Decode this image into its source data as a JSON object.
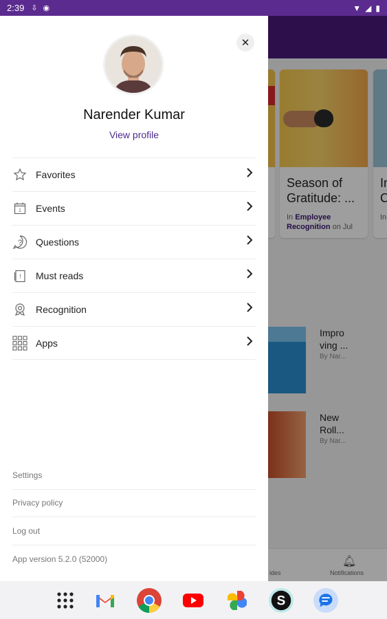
{
  "status_bar": {
    "time": "2:39",
    "icons": [
      "download-icon",
      "messenger-icon",
      "wifi-icon",
      "signal-icon",
      "battery-icon"
    ]
  },
  "background": {
    "cards": [
      {
        "title": "Season of Gratitude: ...",
        "meta_prefix": "In",
        "meta_category": "Employee Recognition",
        "meta_suffix": "on Jul"
      },
      {
        "title": "In C",
        "meta_prefix": "In"
      }
    ],
    "list_items": [
      {
        "title": "Impro ving ...",
        "byline": "By Nar..."
      },
      {
        "title": "New Roll...",
        "byline": "By Nar..."
      }
    ],
    "bottom_nav": {
      "partial_label": "ides",
      "notifications_label": "Notifications"
    }
  },
  "drawer": {
    "user_name": "Narender Kumar",
    "view_profile": "View profile",
    "menu": [
      {
        "label": "Favorites",
        "icon": "star-icon"
      },
      {
        "label": "Events",
        "icon": "calendar-icon"
      },
      {
        "label": "Questions",
        "icon": "question-icon"
      },
      {
        "label": "Must reads",
        "icon": "must-read-icon"
      },
      {
        "label": "Recognition",
        "icon": "recognition-icon"
      },
      {
        "label": "Apps",
        "icon": "apps-grid-icon"
      }
    ],
    "footer": {
      "settings": "Settings",
      "privacy": "Privacy policy",
      "logout": "Log out",
      "version": "App version 5.2.0 (52000)"
    }
  },
  "dock": {
    "apps": [
      "app-drawer-icon",
      "gmail-icon",
      "chrome-icon",
      "youtube-icon",
      "photos-icon",
      "s-app-icon",
      "messages-icon"
    ]
  },
  "colors": {
    "brand_purple": "#4a1a7a",
    "status_bar": "#5b2b8f",
    "link": "#4b2a8a"
  }
}
